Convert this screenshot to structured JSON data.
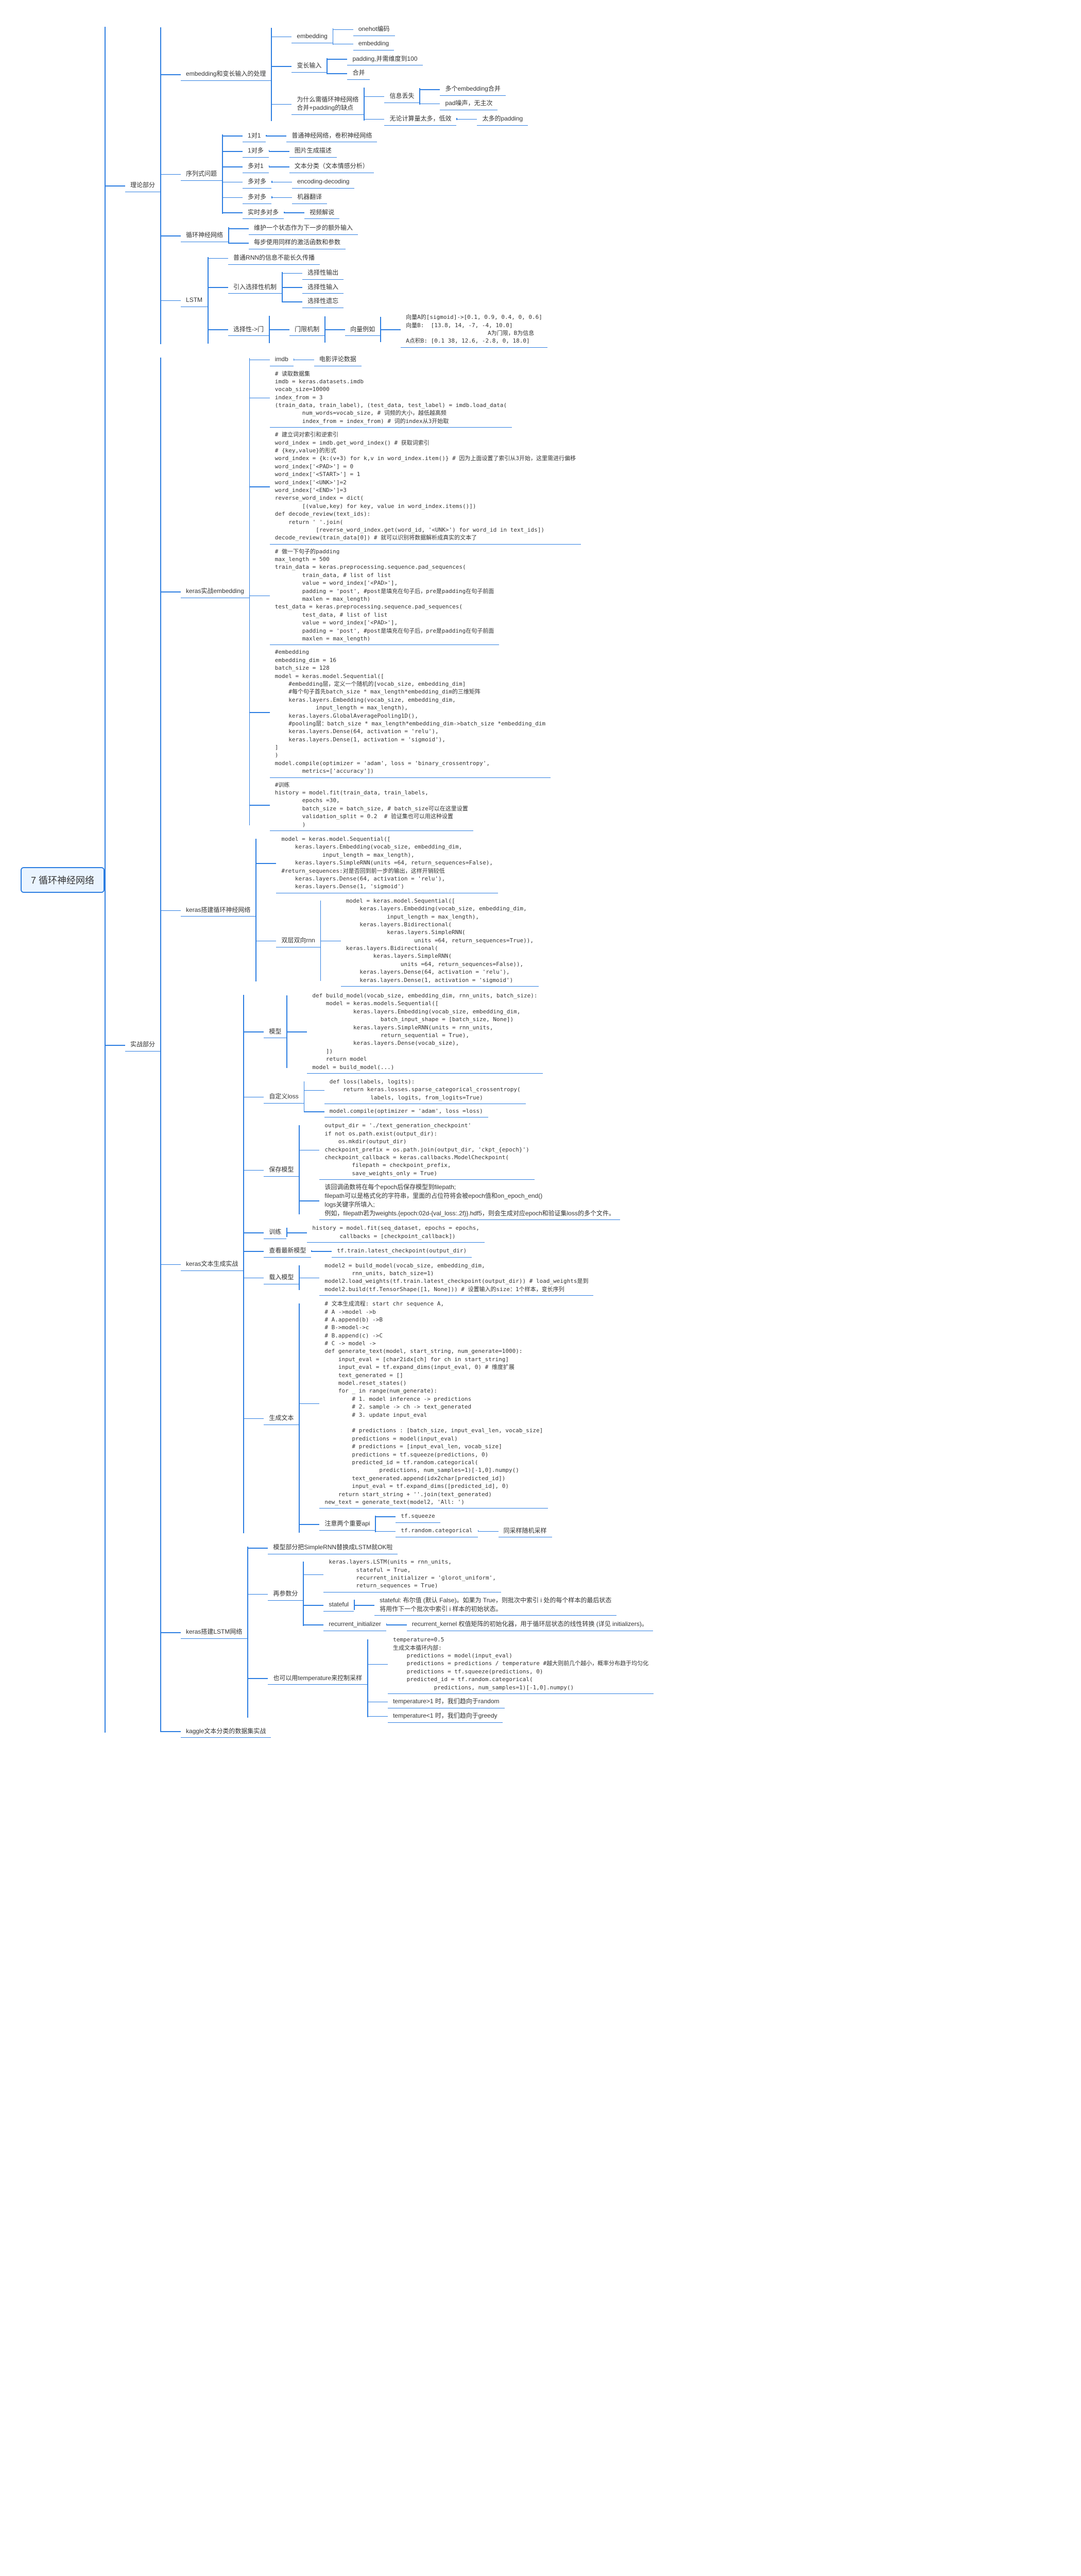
{
  "root": "7 循环神经网络",
  "theory": {
    "title": "理论部分",
    "embedding": {
      "title": "embedding和变长输入的处理",
      "items": {
        "emb": "embedding",
        "emb_c": [
          "onehot编码",
          "embedding"
        ],
        "varlen": "变长输入",
        "varlen_c": [
          "padding,并需维度到100",
          "合并"
        ],
        "why": "为什么需循环神经网络\n合并+padding的缺点",
        "why_c": [
          [
            "信息丢失",
            [
              "多个embedding合并",
              "pad噪声，无主次"
            ]
          ],
          [
            "无论计算量太多，低效",
            [
              "太多的padding"
            ]
          ]
        ]
      }
    },
    "seq": {
      "title": "序列式问题",
      "rows": [
        [
          "1对1",
          "普通神经网络，卷积神经网络"
        ],
        [
          "1对多",
          "图片生成描述"
        ],
        [
          "多对1",
          "文本分类（文本情感分析）"
        ],
        [
          "多对多",
          "encoding-decoding"
        ],
        [
          "多对多",
          "机器翻译"
        ],
        [
          "实时多对多",
          "视频解说"
        ]
      ]
    },
    "rnn_struct": {
      "title": "循环神经网络",
      "c": [
        "维护一个状态作为下一步的额外输入",
        "每步使用同样的激活函数和参数"
      ]
    },
    "lstm": {
      "title": "LSTM",
      "normal": "普通RNN的信息不能长久传播",
      "intro": {
        "t": "引入选择性机制",
        "c": [
          "选择性输出",
          "选择性输入",
          "选择性遗忘"
        ]
      },
      "sel": {
        "t": "选择性->门",
        "gate": "门限机制",
        "ex": {
          "t": "向量例如",
          "content": "向量A的[sigmoid]->[0.1, 0.9, 0.4, 0, 0.6]\n向量B:  [13.8, 14, -7, -4, 10.0]\n                        A为门限，B为信息\nA点积B: [0.1 38, 12.6, -2.8, 0, 18.0]"
        }
      }
    }
  },
  "practice": {
    "title": "实战部分",
    "p1": {
      "title": "keras实战embedding",
      "imdb": {
        "t": "imdb",
        "desc": "电影评论数据"
      },
      "code1": "# 读取数据集\nimdb = keras.datasets.imdb\nvocab_size=10000\nindex_from = 3\n(train_data, train_label), (test_data, test_label) = imdb.load_data(\n        num_words=vocab_size, # 词频的大小，越低越高频\n        index_from = index_from) # 词的index从3开始取",
      "code2": "# 建立词对索引和逆索引\nword_index = imdb.get_word_index() # 获取词索引\n# {key,value}的形式\nword_index = {k:(v+3) for k,v in word_index.item()} # 因为上面设置了索引从3开始，这里需进行偏移\nword_index['<PAD>'] = 0\nword_index['<START>'] = 1\nword_index['<UNK>']=2\nword_index['<END>']=3\nreverse_word_index = dict(\n        [(value,key) for key, value in word_index.items()])\ndef decode_review(text_ids):\n    return ' '.join(\n            [reverse_word_index.get(word_id, '<UNK>') for word_id in text_ids])\ndecode_review(train_data[0]) # 就可以识别将数据解析成真实的文本了",
      "code3": "# 做一下句子的padding\nmax_length = 500\ntrain_data = keras.preprocessing.sequence.pad_sequences(\n        train_data, # list of list\n        value = word_index['<PAD>'],\n        padding = 'post', #post是填充在句子后，pre是padding在句子前面\n        maxlen = max_length)\ntest_data = keras.preprocessing.sequence.pad_sequences(\n        test_data, # list of list\n        value = word_index['<PAD>'],\n        padding = 'post', #post是填充在句子后，pre是padding在句子前面\n        maxlen = max_length)",
      "code4": "#embedding\nembedding_dim = 16\nbatch_size = 128\nmodel = keras.model.Sequential([\n    #embedding层，定义一个随机的[vocab_size, embedding_dim]\n    #每个句子首先batch_size * max_length*embedding_dim的三维矩阵\n    keras.layers.Embedding(vocab_size, embedding_dim,\n            input_length = max_length),\n    keras.layers.GlobalAveragePooling1D(),\n    #pooling层：batch_size * max_length*embedding_dim->batch_size *embedding_dim\n    keras.layers.Dense(64, activation = 'relu'),\n    keras.layers.Dense(1, activation = 'sigmoid'),\n]\n)\nmodel.compile(optimizer = 'adam', loss = 'binary_crossentropy',\n        metrics=['accuracy'])",
      "code5": "#训练\nhistory = model.fit(train_data, train_labels,\n        epochs =30,\n        batch_size = batch_size, # batch_size可以在这里设置\n        validation_split = 0.2  # 验证集也可以用这种设置\n        )"
    },
    "p2": {
      "title": "keras搭建循环神经网络",
      "code1": "model = keras.model.Sequential([\n    keras.layers.Embedding(vocab_size, embedding_dim,\n            input_length = max_length),\n    keras.layers.SimpleRNN(units =64, return_sequences=False),\n#return_sequences:对是否回到前一步的输出，这样开销较低\n    keras.layers.Dense(64, activation = 'relu'),\n    keras.layers.Dense(1, 'sigmoid')",
      "bidir": {
        "title": "双层双向rnn",
        "code": "model = keras.model.Sequential([\n    keras.layers.Embedding(vocab_size, embedding_dim,\n            input_length = max_length),\n    keras.layers.Bidirectional(\n            keras.layers.SimpleRNN(\n                    units =64, return_sequences=True)),\nkeras.layers.Bidirectional(\n        keras.layers.SimpleRNN(\n                units =64, return_sequences=False)),\n    keras.layers.Dense(64, activation = 'relu'),\n    keras.layers.Dense(1, activation = 'sigmoid')"
      }
    },
    "p3": {
      "title": "keras文本生成实战",
      "model": {
        "t": "模型",
        "code": "def build_model(vocab_size, embedding_dim, rnn_units, batch_size):\n    model = keras.models.Sequential([\n            keras.layers.Embedding(vocab_size, embedding_dim,\n                    batch_input_shape = [batch_size, None])\n            keras.layers.SimpleRNN(units = rnn_units,\n                    return_sequential = True),\n            keras.layers.Dense(vocab_size),\n    ])\n    return model\nmodel = build_model(...)"
      },
      "loss": {
        "t": "自定义loss",
        "code": "def loss(labels, logits):\n    return keras.losses.sparse_categorical_crossentropy(\n            labels, logits, from_logits=True)",
        "compile": "model.compile(optimizer = 'adam', loss =loss)"
      },
      "save": {
        "t": "保存模型",
        "code": "output_dir = './text_generation_checkpoint'\nif not os.path.exist(output_dir):\n    os.mkdir(output_dir)\ncheckpoint_prefix = os.path.join(output_dir, 'ckpt_{epoch}')\ncheckpoint_callback = keras.callbacks.ModelCheckpoint(\n        filepath = checkpoint_prefix,\n        save_weights_only = True)",
        "note": "该回调函数将在每个epoch后保存模型到filepath;\nfilepath可以是格式化的字符串，里面的占位符将会被epoch值和on_epoch_end()\nlogs关键字所填入;\n例如，filepath若为weights.{epoch:02d-{val_loss:.2f}}.hdf5，则会生成对应epoch和验证集loss的多个文件。"
      },
      "train": {
        "t": "训练",
        "code": "history = model.fit(seq_dataset, epochs = epochs,\n        callbacks = [checkpoint_callback])"
      },
      "latest": {
        "t": "查看最新模型",
        "code": "tf.train.latest_checkpoint(output_dir)"
      },
      "load": {
        "t": "载入模型",
        "code": "model2 = build_model(vocab_size, embedding_dim,\n        rnn_units, batch_size=1)\nmodel2.load_weights(tf.train.latest_checkpoint(output_dir)) # load_weights是到\nmodel2.build(tf.TensorShape([1, None])) # 设置输入的size：1个样本，变长序列"
      },
      "gen": {
        "t": "生成文本",
        "code": "# 文本生成流程: start chr sequence A,\n# A ->model ->b\n# A.append(b) ->B\n# B->model->c\n# B.append(c) ->C\n# C -> model ->\ndef generate_text(model, start_string, num_generate=1000):\n    input_eval = [char2idx[ch] for ch in start_string]\n    input_eval = tf.expand_dims(input_eval, 0) # 维度扩展\n    text_generated = []\n    model.reset_states()\n    for _ in range(num_generate):\n        # 1. model inference -> predictions\n        # 2. sample -> ch -> text_generated\n        # 3. update input_eval\n\n        # predictions : [batch_size, input_eval_len, vocab_size]\n        predictions = model(input_eval)\n        # predictions = [input_eval_len, vocab_size]\n        predictions = tf.squeeze(predictions, 0)\n        predicted_id = tf.random.categorical(\n                predictions, num_samples=1)[-1,0].numpy()\n        text_generated.append(idx2char[predicted_id])\n        input_eval = tf.expand_dims([predicted_id], 0)\n    return start_string + ''.join(text_generated)\nnew_text = generate_text(model2, 'All: ')",
        "note": {
          "t": "注意两个重要api",
          "items": [
            "tf.squeeze",
            "tf.random.categorical",
            "同采样随机采样"
          ]
        }
      }
    },
    "p4": {
      "title": "keras搭建LSTM网络",
      "top": "模型部分把SimpleRNN替换成LSTM就OK啦",
      "part": {
        "t": "再参数分",
        "code": "keras.layers.LSTM(units = rnn_units,\n        stateful = True,\n        recurrent_initializer = 'glorot_uniform',\n        return_sequences = True)",
        "stateful": {
          "t": "stateful",
          "desc": "stateful: 布尔值 (默认 False)。如果为 True，则批次中索引 i 处的每个样本的最后状态\n将用作下一个批次中索引 i 样本的初始状态。"
        },
        "recurrent": {
          "t": "recurrent_initializer",
          "desc": "recurrent_kernel 权值矩阵的初始化器，用于循环层状态的线性转换 (详见 initializers)。"
        }
      },
      "temp": {
        "t": "也可以用temperature来控制采样",
        "code": "temperature=0.5\n生成文本循环内部:\n    predictions = model(input_eval)\n    predictions = predictions / temperature #越大则前几个越小，概率分布趋于均匀化\n    predictions = tf.squeeze(predictions, 0)\n    predicted_id = tf.random.categorical(\n            predictions, num_samples=1)[-1,0].numpy()",
        "notes": [
          "temperature>1 时，我们趋向于random",
          "temperature<1 时，我们趋向于greedy"
        ]
      }
    },
    "p5": {
      "title": "kaggle文本分类的数据集实战"
    }
  }
}
